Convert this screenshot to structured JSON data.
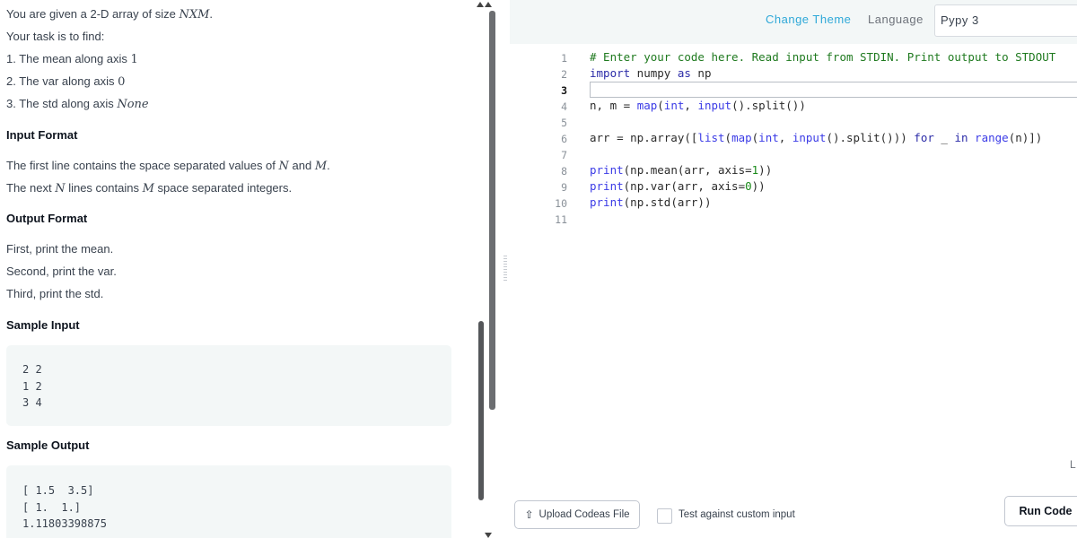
{
  "problem": {
    "intro": [
      "You are given a 2-D array of size ",
      "NXM",
      "."
    ],
    "task": "Your task is to find:",
    "list": [
      {
        "num": "1.",
        "text": "The mean along axis ",
        "arg": "1"
      },
      {
        "num": "2.",
        "text": "The var along axis ",
        "arg": "0"
      },
      {
        "num": "3.",
        "text": "The std along axis ",
        "arg": "None"
      }
    ],
    "input_format_title": "Input Format",
    "input_line1": [
      "The first line contains the space separated values of ",
      "N",
      " and ",
      "M",
      "."
    ],
    "input_line2": [
      "The next ",
      "N",
      " lines contains ",
      "M",
      " space separated integers."
    ],
    "output_format_title": "Output Format",
    "output_lines": [
      "First, print the mean.",
      "Second, print the var.",
      "Third, print the std."
    ],
    "sample_input_title": "Sample Input",
    "sample_input": "2 2\n1 2\n3 4",
    "sample_output_title": "Sample Output",
    "sample_output": "[ 1.5  3.5]\n[ 1.  1.]\n1.11803398875"
  },
  "editor": {
    "change_theme": "Change Theme",
    "language_label": "Language",
    "language_value": "Pypy 3",
    "line_numbers": [
      "1",
      "2",
      "3",
      "4",
      "5",
      "6",
      "7",
      "8",
      "9",
      "10",
      "11"
    ],
    "active_line": "3",
    "code": {
      "l1": "# Enter your code here. Read input from STDIN. Print output to STDOUT",
      "l2_kw": "import",
      "l2_rest": " numpy ",
      "l2_as": "as",
      "l2_np": " np",
      "l4": [
        "n, m = ",
        "map",
        "(",
        "int",
        ", ",
        "input",
        "().split())"
      ],
      "l6": [
        "arr = np.array([",
        "list",
        "(",
        "map",
        "(",
        "int",
        ", ",
        "input",
        "().split())) ",
        "for",
        " _ ",
        "in",
        " ",
        "range",
        "(n)])"
      ],
      "l8": [
        "print",
        "(np.mean(arr, axis=",
        "1",
        "))"
      ],
      "l9": [
        "print",
        "(np.var(arr, axis=",
        "0",
        "))"
      ],
      "l10": [
        "print",
        "(np.std(arr))"
      ]
    },
    "cursor_pos_label": "L"
  },
  "footer": {
    "upload_label": "Upload Codeas File",
    "custom_input_label": "Test against custom input",
    "run_label": "Run Code"
  },
  "colors": {
    "header_bg": "#f3f7f7",
    "link": "#1ba94c",
    "accent": "#2ea8d8"
  }
}
